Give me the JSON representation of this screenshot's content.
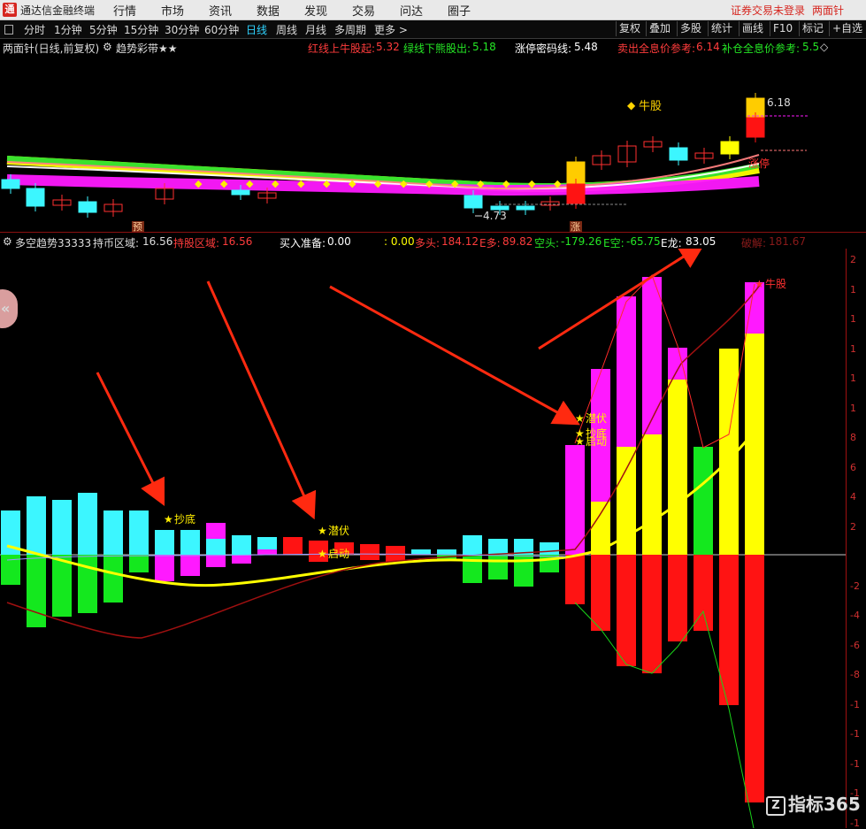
{
  "app": {
    "title": "通达信金融终端",
    "login_status": "证券交易未登录",
    "skin": "两面针"
  },
  "menu": [
    "行情",
    "市场",
    "资讯",
    "数据",
    "发现",
    "交易",
    "问达",
    "圈子"
  ],
  "periods": [
    "分时",
    "1分钟",
    "5分钟",
    "15分钟",
    "30分钟",
    "60分钟",
    "日线",
    "周线",
    "月线",
    "多周期",
    "更多 >"
  ],
  "active_period": "日线",
  "right_buttons": [
    "复权",
    "叠加",
    "多股",
    "统计",
    "画线",
    "F10",
    "标记",
    "+自选"
  ],
  "stock_header": {
    "name": "两面针(日线,前复权)",
    "indicator": "趋势彩带★★",
    "red_line_label": "红线上牛股起:",
    "red_line_value": "5.32",
    "green_line_label": "绿线下熊股出:",
    "green_line_value": "5.18",
    "limit_label": "涨停密码线:",
    "limit_value": "5.48",
    "sell_label": "卖出全息价参考:",
    "sell_value": "6.14",
    "add_label": "补仓全息价参考:",
    "add_value": "5.5"
  },
  "top_chart": {
    "high_label": "6.18",
    "low_label": "4.73",
    "bull_label": "牛股",
    "limit_up_label": "涨停",
    "pre_tag": "预",
    "zhang_tag": "涨"
  },
  "indicator_bar": {
    "name": "多空趋势33333",
    "hold_coin_label": "持币区域:",
    "hold_coin_value": "16.56",
    "hold_stock_label": "持股区域:",
    "hold_stock_value": "16.56",
    "buy_ready_label": "买入准备:",
    "buy_ready_value": "0.00",
    "colon_value": ": 0.00",
    "bull_label": "多头:",
    "bull_value": "184.12",
    "e_bull_label": "E多:",
    "e_bull_value": "89.82",
    "bear_label": "空头:",
    "bear_value": "-179.26",
    "e_bear_label": "E空:",
    "e_bear_value": "-65.75",
    "e_dragon_label": "E龙:",
    "e_dragon_value": "83.05",
    "crack_label": "破解:",
    "crack_value": "181.67"
  },
  "signals": {
    "bottom1": "抄底",
    "hide1": "潜伏",
    "start1": "启动",
    "hide2": "潜伏",
    "bottom2": "抄底",
    "start2": "启动",
    "bull": "牛股"
  },
  "axis_ticks": [
    "2",
    "1",
    "1",
    "1",
    "1",
    "1",
    "8",
    "6",
    "4",
    "2",
    "",
    "-2",
    "-4",
    "-6",
    "-8",
    "-1",
    "-1",
    "-1",
    "-1",
    "-1"
  ],
  "watermark": "指标365",
  "colors": {
    "cyan": "#3cf6ff",
    "green": "#14e81e",
    "magenta": "#ff19ff",
    "red": "#ff1313",
    "yellow": "#ffff00",
    "darkred": "#a01010"
  }
}
